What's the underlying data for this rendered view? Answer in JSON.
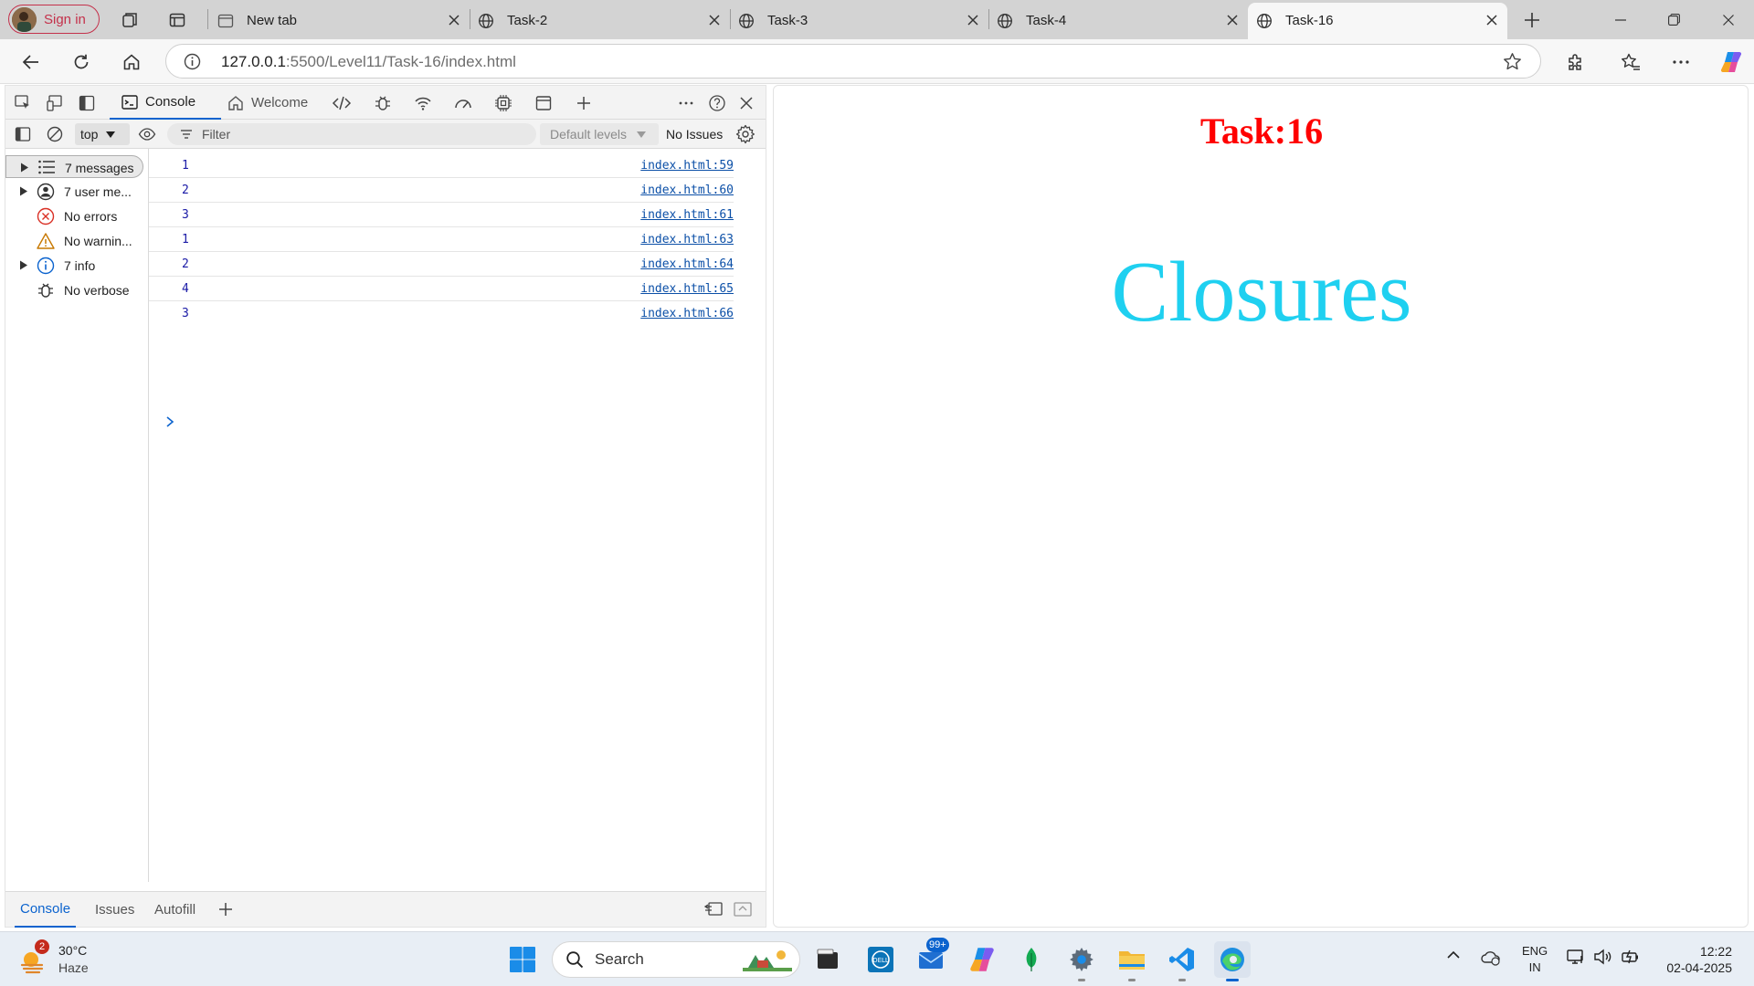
{
  "browser": {
    "profile_label": "Sign in",
    "tabs": [
      {
        "title": "New tab",
        "icon": "newtab-icon",
        "active": false
      },
      {
        "title": "Task-2",
        "icon": "globe-icon",
        "active": false
      },
      {
        "title": "Task-3",
        "icon": "globe-icon",
        "active": false
      },
      {
        "title": "Task-4",
        "icon": "globe-icon",
        "active": false
      },
      {
        "title": "Task-16",
        "icon": "globe-icon",
        "active": true
      }
    ],
    "url_host": "127.0.0.1",
    "url_rest": ":5500/Level11/Task-16/index.html"
  },
  "devtools": {
    "tabs": [
      {
        "label": "Console",
        "active": true
      },
      {
        "label": "Welcome",
        "active": false
      }
    ],
    "context": "top",
    "filter_placeholder": "Filter",
    "levels": "Default levels",
    "issues": "No Issues",
    "sidebar": [
      {
        "label": "7 messages",
        "icon": "list-icon",
        "expandable": true,
        "selected": true
      },
      {
        "label": "7 user me...",
        "icon": "user-icon",
        "expandable": true,
        "selected": false
      },
      {
        "label": "No errors",
        "icon": "error-icon",
        "expandable": false,
        "selected": false
      },
      {
        "label": "No warnin...",
        "icon": "warning-icon",
        "expandable": false,
        "selected": false
      },
      {
        "label": "7 info",
        "icon": "info-icon",
        "expandable": true,
        "selected": false
      },
      {
        "label": "No verbose",
        "icon": "bug-icon",
        "expandable": false,
        "selected": false
      }
    ],
    "logs": [
      {
        "value": "1",
        "source": "index.html:59"
      },
      {
        "value": "2",
        "source": "index.html:60"
      },
      {
        "value": "3",
        "source": "index.html:61"
      },
      {
        "value": "1",
        "source": "index.html:63"
      },
      {
        "value": "2",
        "source": "index.html:64"
      },
      {
        "value": "4",
        "source": "index.html:65"
      },
      {
        "value": "3",
        "source": "index.html:66"
      }
    ],
    "drawer_tabs": [
      {
        "label": "Console",
        "active": true
      },
      {
        "label": "Issues",
        "active": false
      },
      {
        "label": "Autofill",
        "active": false
      }
    ]
  },
  "page": {
    "title": "Task:16",
    "heading": "Closures",
    "title_color": "#ff0000",
    "heading_color": "#1fd0f0"
  },
  "taskbar": {
    "weather_badge": "2",
    "temperature": "30°C",
    "condition": "Haze",
    "search_label": "Search",
    "mail_badge": "99+",
    "lang_line1": "ENG",
    "lang_line2": "IN",
    "time": "12:22",
    "date": "02-04-2025"
  }
}
